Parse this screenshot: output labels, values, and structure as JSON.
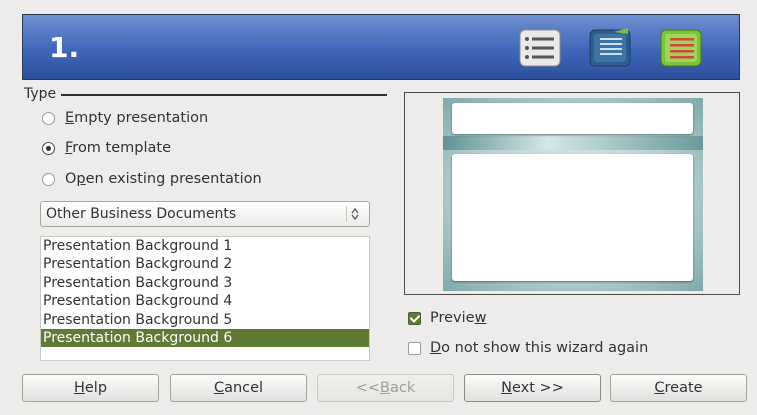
{
  "banner": {
    "step_number": "1.",
    "icons": [
      "list-icon",
      "notes-list-icon",
      "outline-list-icon"
    ]
  },
  "type_section": {
    "label": "Type",
    "options": [
      {
        "pre": "",
        "accel": "E",
        "post": "mpty presentation",
        "checked": false
      },
      {
        "pre": "",
        "accel": "F",
        "post": "rom template",
        "checked": true
      },
      {
        "pre": "O",
        "accel": "p",
        "post": "en existing presentation",
        "checked": false
      }
    ]
  },
  "category_select": {
    "value": "Other Business Documents"
  },
  "template_list": {
    "items": [
      "Presentation Background 1",
      "Presentation Background 2",
      "Presentation Background 3",
      "Presentation Background 4",
      "Presentation Background 5",
      "Presentation Background 6"
    ],
    "selected_index": 5
  },
  "preview_checkbox": {
    "pre": "Previe",
    "accel": "w",
    "post": "",
    "checked": true
  },
  "no_show_checkbox": {
    "pre": "",
    "accel": "D",
    "post": "o not show this wizard again",
    "checked": false
  },
  "buttons": {
    "help": {
      "pre": "",
      "accel": "H",
      "post": "elp"
    },
    "cancel": {
      "pre": "",
      "accel": "C",
      "post": "ancel"
    },
    "back": {
      "pre": "<< ",
      "accel": "B",
      "post": "ack"
    },
    "next": {
      "pre": "",
      "accel": "N",
      "post": "ext >>"
    },
    "create": {
      "pre": "",
      "accel": "C",
      "post": "reate"
    }
  },
  "colors": {
    "banner_top": "#6f8fcf",
    "banner_bottom": "#2c4f9c",
    "selection": "#5e7a34",
    "window_bg": "#edeceb"
  }
}
